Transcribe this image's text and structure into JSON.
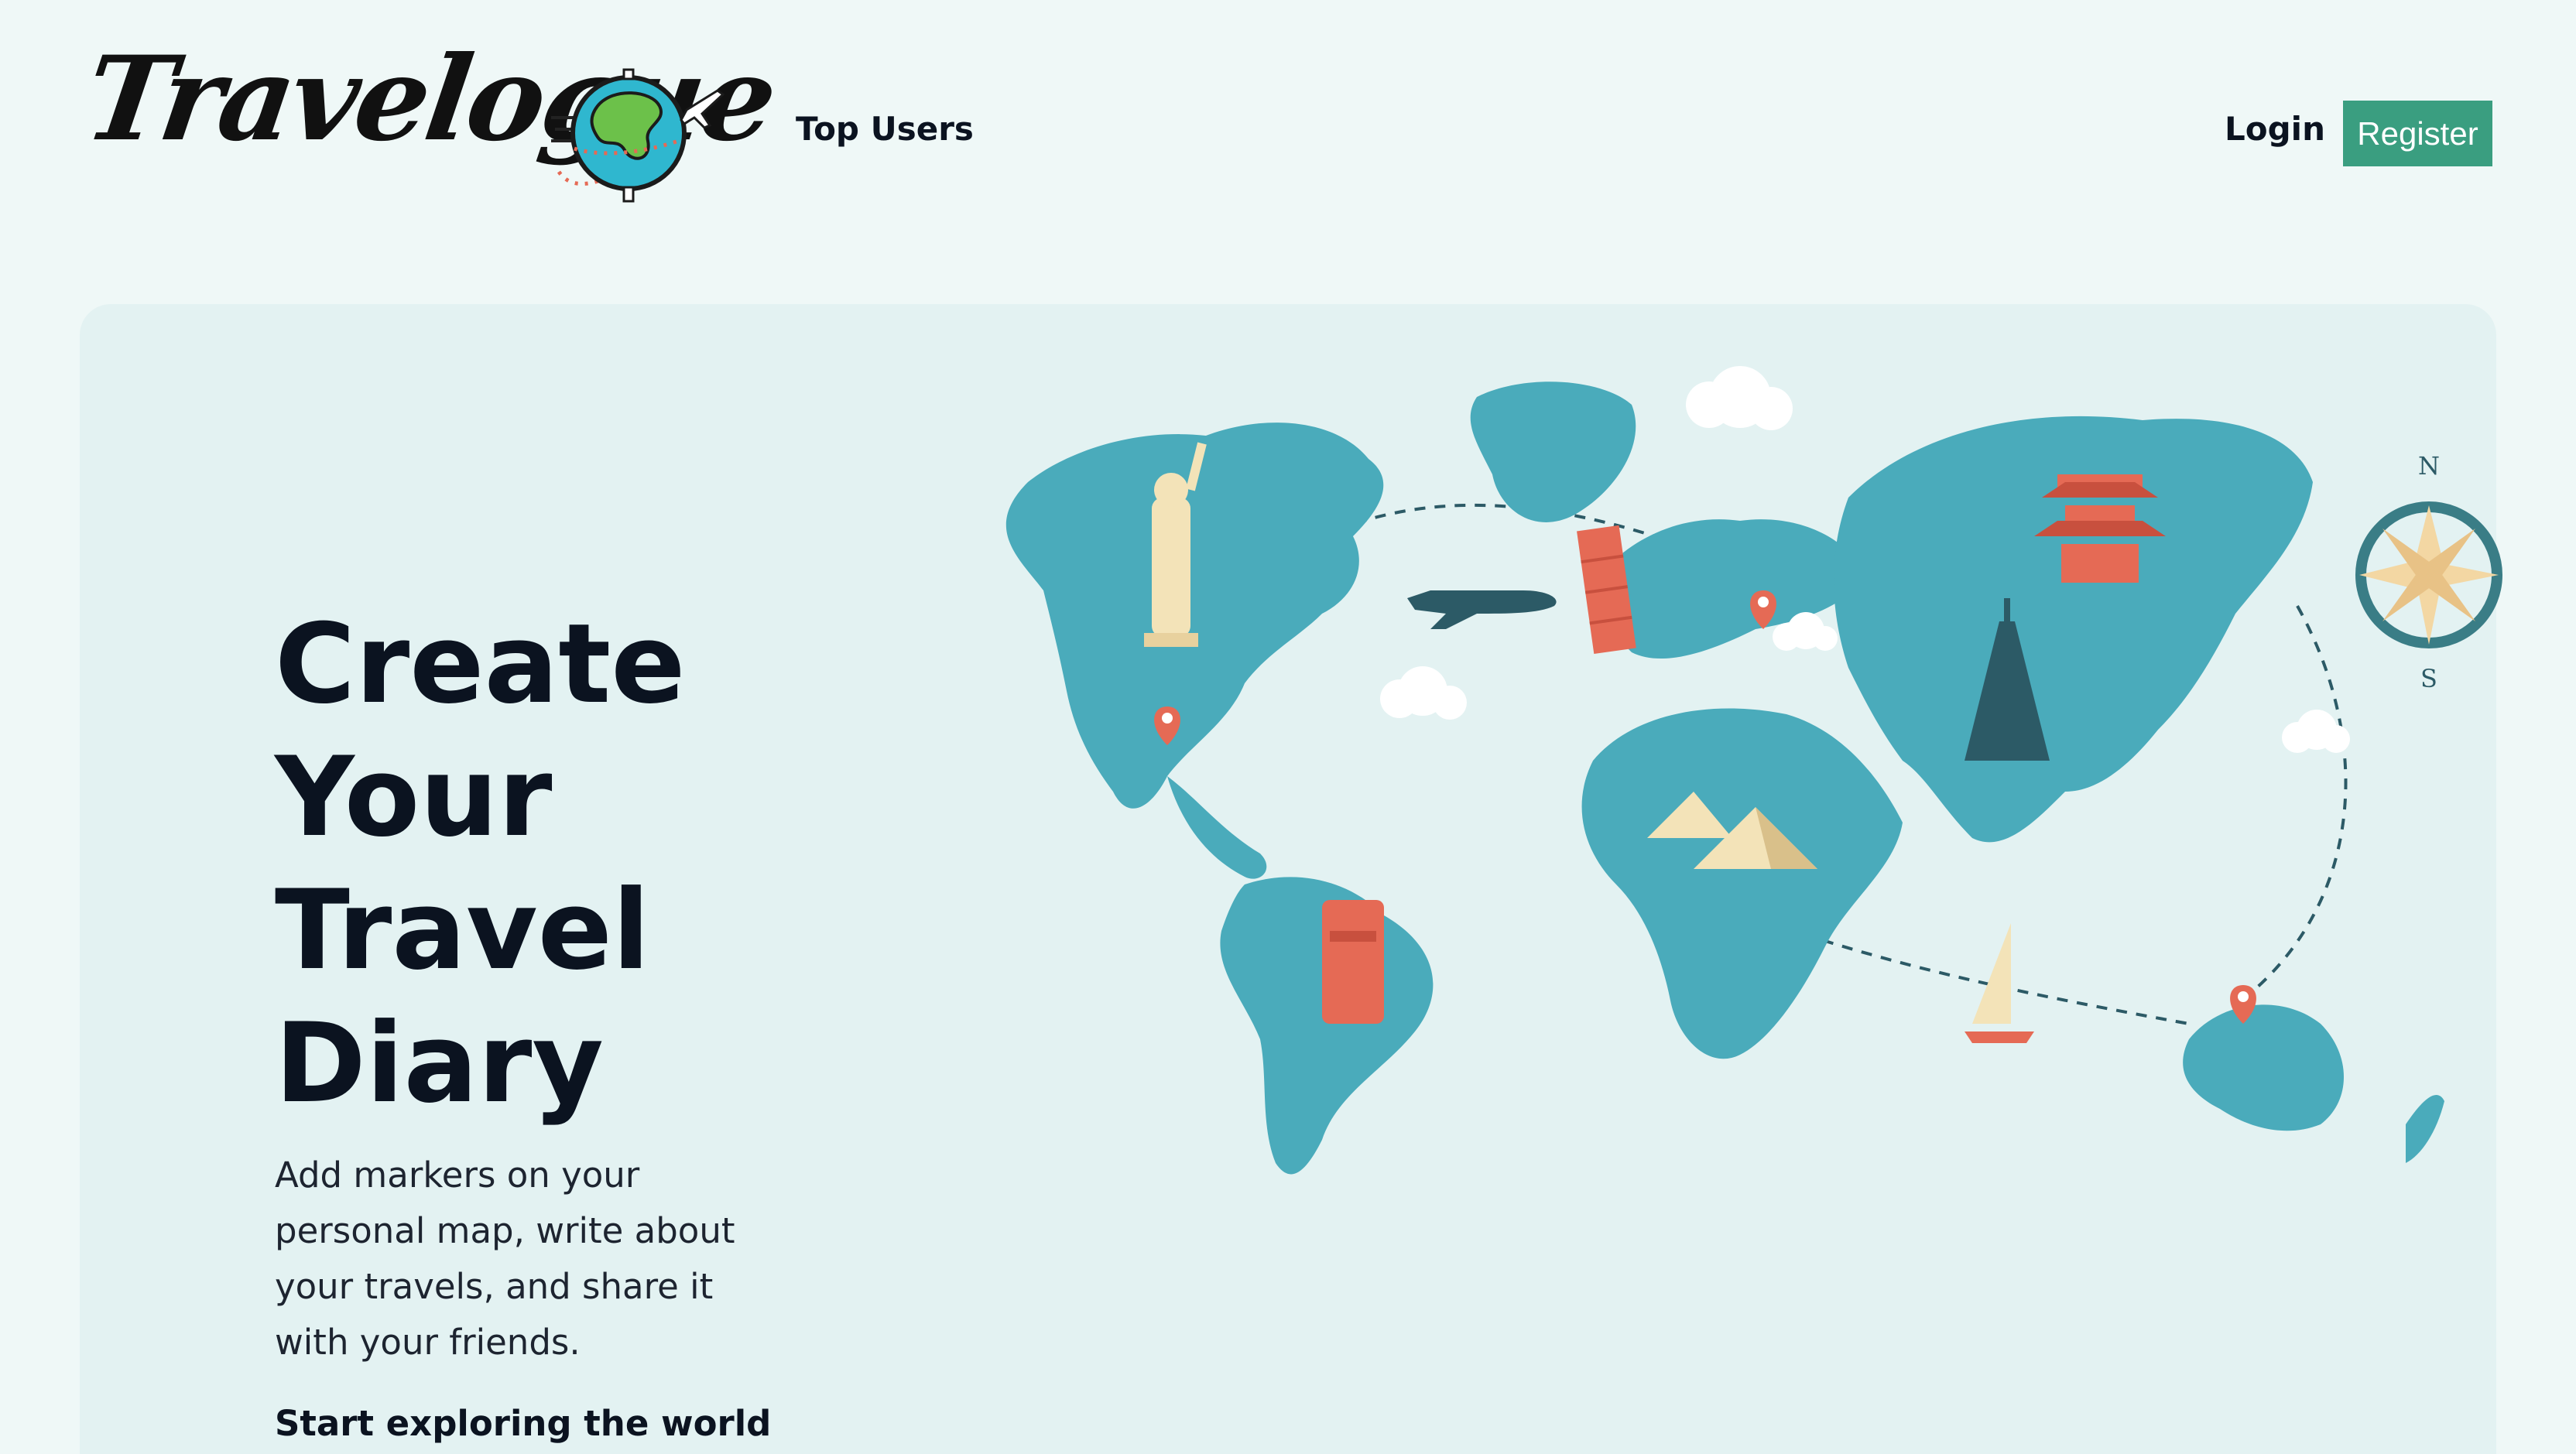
{
  "header": {
    "logo_text": "Travelogue",
    "nav": {
      "top_users": "Top Users",
      "login": "Login",
      "register": "Register"
    }
  },
  "hero": {
    "title_lines": [
      "Create",
      "Your",
      "Travel",
      "Diary"
    ],
    "subtitle": "Add markers on your personal map, write about your travels, and share it with your friends.",
    "cta": "Start exploring the world"
  },
  "map": {
    "compass_north": "N",
    "compass_south": "S"
  },
  "colors": {
    "page_bg": "#eff8f7",
    "hero_bg": "#e3f2f2",
    "register_bg": "#3a9e80",
    "map_land": "#4aabbb",
    "accent_red": "#e56a55"
  }
}
